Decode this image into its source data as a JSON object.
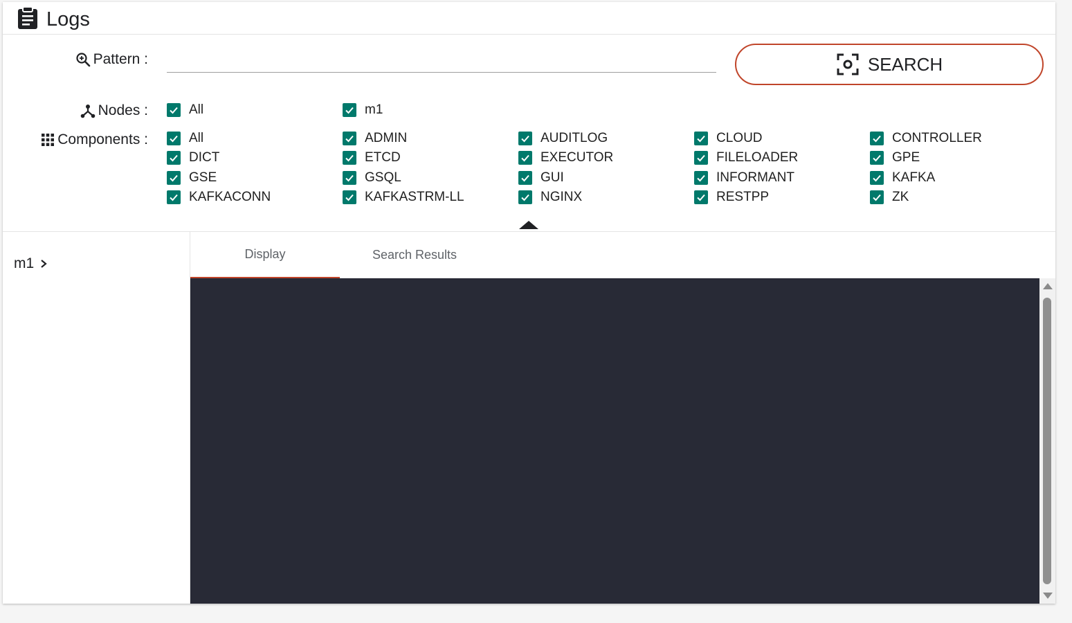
{
  "header": {
    "title": "Logs",
    "icon": "clipboard-icon"
  },
  "pattern": {
    "label": "Pattern :",
    "value": "",
    "placeholder": ""
  },
  "search_button": {
    "label": "SEARCH"
  },
  "nodes": {
    "label": "Nodes :",
    "items": [
      "All",
      "m1"
    ]
  },
  "components": {
    "label": "Components :",
    "items": [
      "All",
      "ADMIN",
      "AUDITLOG",
      "CLOUD",
      "CONTROLLER",
      "DICT",
      "ETCD",
      "EXECUTOR",
      "FILELOADER",
      "GPE",
      "GSE",
      "GSQL",
      "GUI",
      "INFORMANT",
      "KAFKA",
      "KAFKACONN",
      "KAFKASTRM-LL",
      "NGINX",
      "RESTPP",
      "ZK"
    ]
  },
  "tree": {
    "node": "m1"
  },
  "tabs": [
    "Display",
    "Search Results"
  ],
  "colors": {
    "accent": "#c0452a",
    "checkbox": "#00796b",
    "console_bg": "#282a36"
  }
}
